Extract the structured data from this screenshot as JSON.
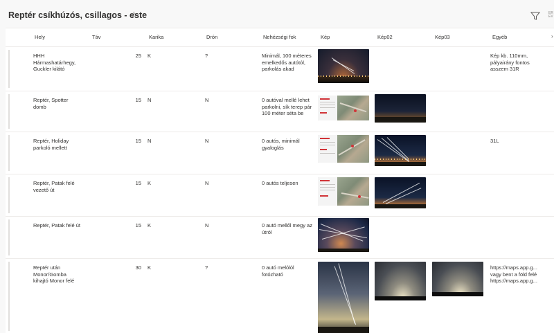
{
  "title": "Reptér csíkhúzós, csillagos - este",
  "icons": {
    "favorite": "star-icon",
    "filter": "filter-icon",
    "more": "chevron-right-icon"
  },
  "topright_text": [
    "ER",
    "EV"
  ],
  "columns": [
    "Hely",
    "Táv",
    "Karika",
    "Drón",
    "Nehézségi fok",
    "Kép",
    "Kép02",
    "Kép03",
    "Egyéb"
  ],
  "rows": [
    {
      "hely": "HHH Hármashatárhegy, Guckler kilátó",
      "tav": "25",
      "karika": "K",
      "dron": "?",
      "nehezseg": "Minimál, 100 méteres emelkedős autótól, parkolás akad",
      "egyeb": "Kép kb. 110mm, pályairány fontos asszem 31R"
    },
    {
      "hely": "Reptér, Spotter domb",
      "tav": "15",
      "karika": "N",
      "dron": "N",
      "nehezseg": "0 autóval mellé lehet parkolni, sík terep pár 100 méter séta be",
      "egyeb": ""
    },
    {
      "hely": "Reptér, Holiday parkoló mellett",
      "tav": "15",
      "karika": "N",
      "dron": "N",
      "nehezseg": "0 autós, minimál gyaloglás",
      "egyeb": "31L"
    },
    {
      "hely": "Reptér, Patak felé vezető út",
      "tav": "15",
      "karika": "K",
      "dron": "N",
      "nehezseg": "0 autós teljesen",
      "egyeb": ""
    },
    {
      "hely": "Reptér, Patak felé út",
      "tav": "15",
      "karika": "K",
      "dron": "N",
      "nehezseg": "0 autó mellől megy az útról",
      "egyeb": ""
    },
    {
      "hely": "Reptér után Monor/Gomba kihajtó Monor felé",
      "tav": "30",
      "karika": "K",
      "dron": "?",
      "nehezseg": "0 autó melólól fotózható",
      "egyeb_lines": [
        "https://maps.app.g...",
        "vagy bent a föld felé",
        "https://maps.app.g..."
      ]
    }
  ],
  "colors": {
    "accent_red": "#d13438",
    "border": "#edebe9",
    "text": "#323130"
  }
}
